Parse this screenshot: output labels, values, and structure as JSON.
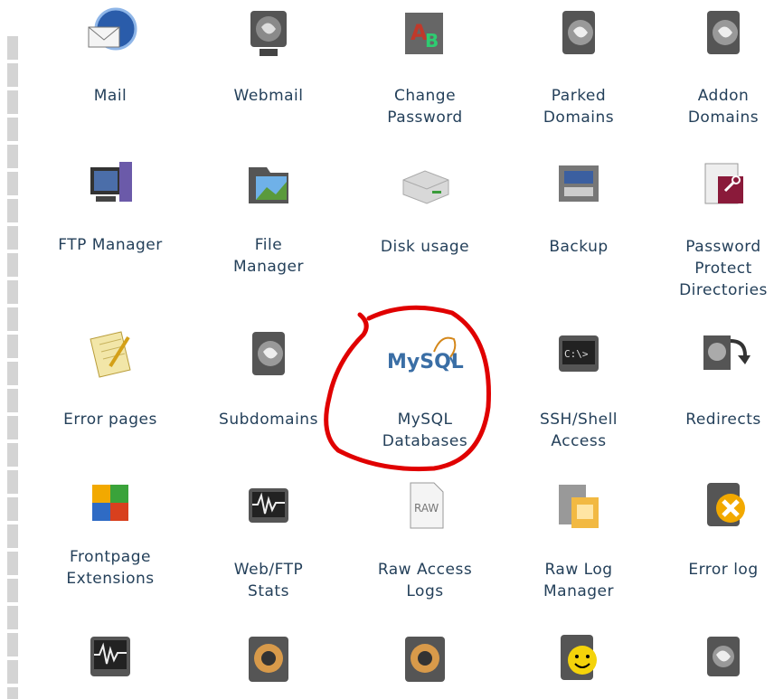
{
  "grid": [
    {
      "label": "Mail",
      "icon": "mail-icon"
    },
    {
      "label": "Webmail",
      "icon": "webmail-icon"
    },
    {
      "label": "Change\nPassword",
      "icon": "change-password-icon"
    },
    {
      "label": "Parked\nDomains",
      "icon": "parked-domains-icon"
    },
    {
      "label": "Addon\nDomains",
      "icon": "addon-domains-icon"
    },
    {
      "label": "FTP Manager",
      "icon": "ftp-manager-icon"
    },
    {
      "label": "File\nManager",
      "icon": "file-manager-icon"
    },
    {
      "label": "Disk usage",
      "icon": "disk-usage-icon"
    },
    {
      "label": "Backup",
      "icon": "backup-icon"
    },
    {
      "label": "Password\nProtect\nDirectories",
      "icon": "password-protect-icon"
    },
    {
      "label": "Error pages",
      "icon": "error-pages-icon"
    },
    {
      "label": "Subdomains",
      "icon": "subdomains-icon"
    },
    {
      "label": "MySQL\nDatabases",
      "icon": "mysql-icon",
      "logo_text": "MySQL"
    },
    {
      "label": "SSH/Shell\nAccess",
      "icon": "ssh-shell-icon"
    },
    {
      "label": "Redirects",
      "icon": "redirects-icon"
    },
    {
      "label": "Frontpage\nExtensions",
      "icon": "frontpage-icon"
    },
    {
      "label": "Web/FTP\nStats",
      "icon": "web-ftp-stats-icon"
    },
    {
      "label": "Raw Access\nLogs",
      "icon": "raw-access-logs-icon",
      "badge": "RAW"
    },
    {
      "label": "Raw Log\nManager",
      "icon": "raw-log-manager-icon"
    },
    {
      "label": "Error log",
      "icon": "error-log-icon"
    },
    {
      "label": "",
      "icon": "analog-stats-icon"
    },
    {
      "label": "",
      "icon": "awstats-icon"
    },
    {
      "label": "",
      "icon": "webalizer-icon"
    },
    {
      "label": "",
      "icon": "smiley-icon"
    },
    {
      "label": "",
      "icon": "monitor-icon"
    }
  ],
  "colors": {
    "label": "#24405a",
    "annotation": "#e00000"
  }
}
